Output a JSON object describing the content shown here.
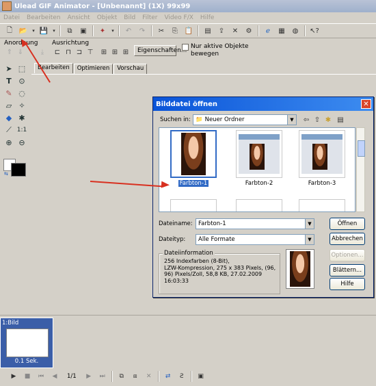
{
  "app": {
    "title": "Ulead GIF Animator - [Unbenannt] (1X) 99x99"
  },
  "menu": [
    "Datei",
    "Bearbeiten",
    "Ansicht",
    "Objekt",
    "Bild",
    "Filter",
    "Video F/X",
    "Hilfe"
  ],
  "toolbar2": {
    "anordnung_label": "Anordnung",
    "ausrichtung_label": "Ausrichtung",
    "eigenschaften_button": "Eigenschaften...",
    "nur_aktive_label_1": "Nur aktive Objekte",
    "nur_aktive_label_2": "bewegen",
    "nur_aktive_checked": false
  },
  "tabs": [
    "Bearbeiten",
    "Optimieren",
    "Vorschau"
  ],
  "dialog": {
    "title": "Bilddatei öffnen",
    "close_glyph": "✕",
    "lookin_label": "Suchen in:",
    "lookin_value": "Neuer Ordner",
    "thumbnails": [
      {
        "label": "Farbton-1",
        "selected": true
      },
      {
        "label": "Farbton-2",
        "selected": false
      },
      {
        "label": "Farbton-3",
        "selected": false
      }
    ],
    "filename_label": "Dateiname:",
    "filename_value": "Farbton-1",
    "filetype_label": "Dateityp:",
    "filetype_value": "Alle Formate",
    "fileinfo_title": "Dateiinformation",
    "fileinfo_lines": [
      "256 Indexfarben (8-Bit),",
      "LZW-Kompression, 275 x 383 Pixels,  (96,",
      "96) Pixels/Zoll,  58,8 KB,  27.02.2009",
      "16:03:33"
    ],
    "buttons": {
      "open": "Öffnen",
      "cancel": "Abbrechen",
      "options": "Optionen...",
      "browse": "Blättern...",
      "help": "Hilfe"
    }
  },
  "frames": {
    "frame_label": "1:Bild",
    "frame_delay": "0.1 Sek.",
    "counter": "1/1"
  },
  "colors": {
    "titlebar_start": "#b9c3d6",
    "dialog_title": "#0a54d8",
    "selection": "#316ac5",
    "annotation_arrow": "#d83020"
  }
}
